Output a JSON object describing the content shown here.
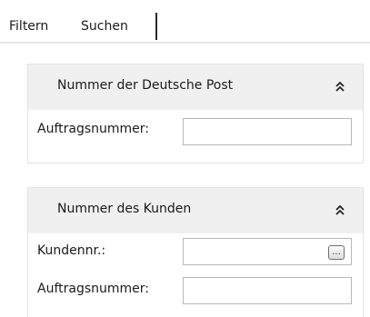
{
  "tabs": [
    {
      "label": "Filtern"
    },
    {
      "label": "Suchen",
      "active": true
    }
  ],
  "panels": [
    {
      "title": "Nummer der Deutsche Post",
      "collapse_icon": "double-chevron-up-icon",
      "fields": [
        {
          "label": "Auftragsnummer:",
          "value": "",
          "placeholder": ""
        }
      ]
    },
    {
      "title": "Nummer des Kunden",
      "collapse_icon": "double-chevron-up-icon",
      "fields": [
        {
          "label": "Kundennr.:",
          "value": "",
          "placeholder": "",
          "lookup_button": "..."
        },
        {
          "label": "Auftragsnummer:",
          "value": "",
          "placeholder": ""
        }
      ]
    }
  ]
}
